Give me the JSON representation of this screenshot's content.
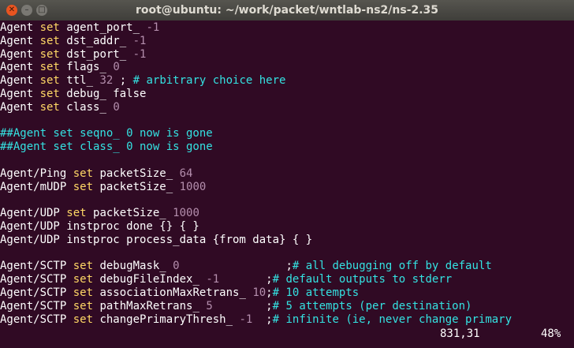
{
  "window": {
    "title": "root@ubuntu: ~/work/packet/wntlab-ns2/ns-2.35",
    "close_glyph": "✕",
    "minimize_glyph": "–",
    "maximize_glyph": "□"
  },
  "editor": {
    "lines": [
      [
        [
          "t",
          "Agent "
        ],
        [
          "k",
          "set"
        ],
        [
          "t",
          " agent_port_ "
        ],
        [
          "n",
          "-1"
        ]
      ],
      [
        [
          "t",
          "Agent "
        ],
        [
          "k",
          "set"
        ],
        [
          "t",
          " dst_addr_ "
        ],
        [
          "n",
          "-1"
        ]
      ],
      [
        [
          "t",
          "Agent "
        ],
        [
          "k",
          "set"
        ],
        [
          "t",
          " dst_port_ "
        ],
        [
          "n",
          "-1"
        ]
      ],
      [
        [
          "t",
          "Agent "
        ],
        [
          "k",
          "set"
        ],
        [
          "t",
          " flags_ "
        ],
        [
          "n",
          "0"
        ]
      ],
      [
        [
          "t",
          "Agent "
        ],
        [
          "k",
          "set"
        ],
        [
          "t",
          " ttl_ "
        ],
        [
          "n",
          "32"
        ],
        [
          "t",
          " ; "
        ],
        [
          "c",
          "# arbitrary choice here"
        ]
      ],
      [
        [
          "t",
          "Agent "
        ],
        [
          "k",
          "set"
        ],
        [
          "t",
          " debug_ false"
        ]
      ],
      [
        [
          "t",
          "Agent "
        ],
        [
          "k",
          "set"
        ],
        [
          "t",
          " class_ "
        ],
        [
          "n",
          "0"
        ]
      ],
      [],
      [
        [
          "c",
          "##Agent set seqno_ 0 now is gone"
        ]
      ],
      [
        [
          "c",
          "##Agent set class_ 0 now is gone"
        ]
      ],
      [],
      [
        [
          "t",
          "Agent/Ping "
        ],
        [
          "k",
          "set"
        ],
        [
          "t",
          " packetSize_ "
        ],
        [
          "n",
          "64"
        ]
      ],
      [
        [
          "t",
          "Agent/mUDP "
        ],
        [
          "k",
          "set"
        ],
        [
          "t",
          " packetSize_ "
        ],
        [
          "n",
          "1000"
        ]
      ],
      [],
      [
        [
          "t",
          "Agent/UDP "
        ],
        [
          "k",
          "set"
        ],
        [
          "t",
          " packetSize_ "
        ],
        [
          "n",
          "1000"
        ]
      ],
      [
        [
          "t",
          "Agent/UDP instproc done {} { }"
        ]
      ],
      [
        [
          "t",
          "Agent/UDP instproc process_data {from data} { }"
        ]
      ],
      [],
      [
        [
          "t",
          "Agent/SCTP "
        ],
        [
          "k",
          "set"
        ],
        [
          "t",
          " debugMask_ "
        ],
        [
          "n",
          "0"
        ],
        [
          "t",
          "                ;"
        ],
        [
          "c",
          "# all debugging off by default"
        ]
      ],
      [
        [
          "t",
          "Agent/SCTP "
        ],
        [
          "k",
          "set"
        ],
        [
          "t",
          " debugFileIndex_ "
        ],
        [
          "n",
          "-1"
        ],
        [
          "t",
          "       ;"
        ],
        [
          "c",
          "# default outputs to stderr"
        ]
      ],
      [
        [
          "t",
          "Agent/SCTP "
        ],
        [
          "k",
          "set"
        ],
        [
          "t",
          " associationMaxRetrans_ "
        ],
        [
          "n",
          "10"
        ],
        [
          "t",
          ";"
        ],
        [
          "c",
          "# 10 attempts"
        ]
      ],
      [
        [
          "t",
          "Agent/SCTP "
        ],
        [
          "k",
          "set"
        ],
        [
          "t",
          " pathMaxRetrans_ "
        ],
        [
          "n",
          "5"
        ],
        [
          "t",
          "        ;"
        ],
        [
          "c",
          "# 5 attempts (per destination)"
        ]
      ],
      [
        [
          "t",
          "Agent/SCTP "
        ],
        [
          "k",
          "set"
        ],
        [
          "t",
          " changePrimaryThresh_ "
        ],
        [
          "n",
          "-1"
        ],
        [
          "t",
          "  ;"
        ],
        [
          "c",
          "# infinite (ie, never change primary"
        ]
      ]
    ],
    "status": {
      "position": "831,31",
      "percent": "48%"
    }
  }
}
